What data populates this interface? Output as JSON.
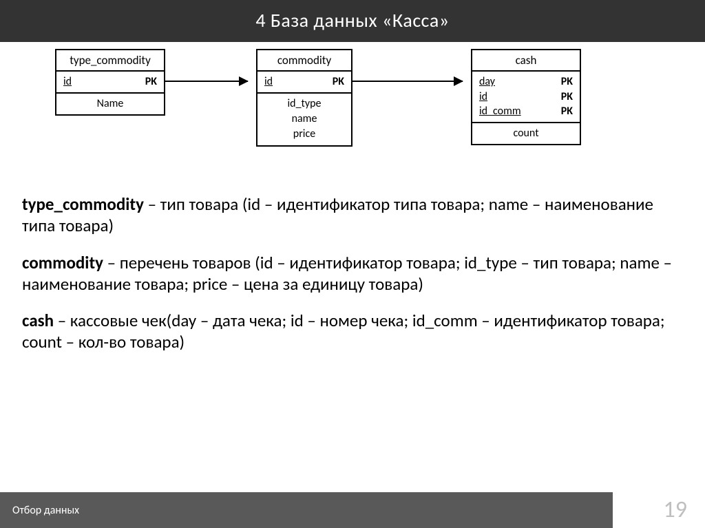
{
  "header": {
    "title": "4  База данных «Касса»"
  },
  "tables": {
    "type_commodity": {
      "name": "type_commodity",
      "pk": [
        {
          "field": "id",
          "label": "PK"
        }
      ],
      "attrs": [
        "Name"
      ]
    },
    "commodity": {
      "name": "commodity",
      "pk": [
        {
          "field": "id",
          "label": "PK"
        }
      ],
      "attrs": [
        "id_type",
        "name",
        "price"
      ]
    },
    "cash": {
      "name": "cash",
      "pk": [
        {
          "field": "day",
          "label": "PK"
        },
        {
          "field": "id",
          "label": "PK"
        },
        {
          "field": "id_comm",
          "label": "PK"
        }
      ],
      "attrs": [
        "count"
      ]
    }
  },
  "descriptions": {
    "d1": {
      "bold": "type_commodity",
      "rest": " – тип товара (id – идентификатор типа товара; name – наименование типа товара)"
    },
    "d2": {
      "bold": "commodity",
      "rest": " – перечень товаров (id – идентификатор товара; id_type – тип товара; name – наименование товара; price – цена за единицу товара)"
    },
    "d3": {
      "bold": "cash",
      "rest": " – кассовые чек(day – дата чека; id – номер чека; id_comm – идентификатор товара; count – кол-во товара)"
    }
  },
  "footer": {
    "text": "Отбор данных",
    "page": "19"
  },
  "chart_data": {
    "type": "table",
    "title": "ER-диаграмма базы данных «Касса»",
    "entities": [
      {
        "name": "type_commodity",
        "primary_key": [
          "id"
        ],
        "attributes": [
          "Name"
        ]
      },
      {
        "name": "commodity",
        "primary_key": [
          "id"
        ],
        "attributes": [
          "id_type",
          "name",
          "price"
        ]
      },
      {
        "name": "cash",
        "primary_key": [
          "day",
          "id",
          "id_comm"
        ],
        "attributes": [
          "count"
        ]
      }
    ],
    "relationships": [
      {
        "from": "type_commodity",
        "to": "commodity"
      },
      {
        "from": "commodity",
        "to": "cash"
      }
    ]
  }
}
